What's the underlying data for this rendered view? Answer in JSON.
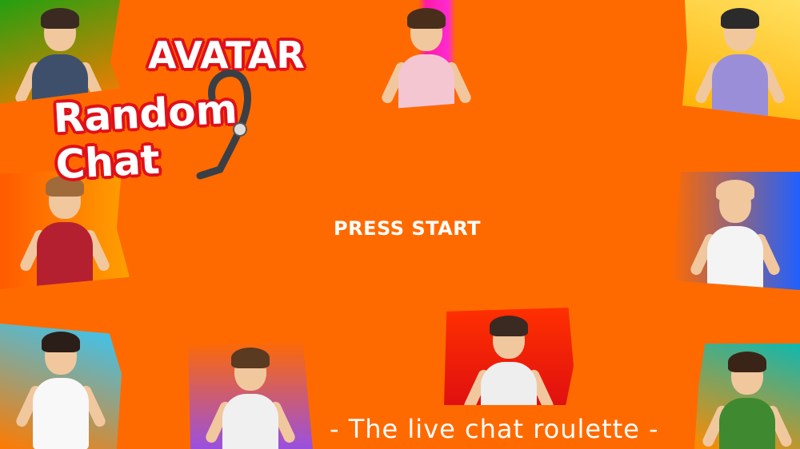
{
  "logo": {
    "line1": "AVATAR",
    "line2": "Random Chat"
  },
  "prompt": "PRESS START",
  "tagline": "- The live chat roulette -",
  "colors": {
    "background": "#ff6a00",
    "text": "#ffffff",
    "logo_outline": "#e0101a"
  },
  "avatars": [
    {
      "id": "top-left",
      "bg": "linear-gradient(160deg,#22a010,#ff7a00)",
      "shirt": "#3e4f6b",
      "hair": "#3a2a22"
    },
    {
      "id": "top-center",
      "bg": "linear-gradient(90deg,#ff6a00 0%,#ff6a00 45%,#ff1aa8 50%,#ff2ad0 65%,#ff6a00 70%)",
      "shirt": "#f4c6d2",
      "hair": "#4a2e1c"
    },
    {
      "id": "top-right",
      "bg": "linear-gradient(200deg,#ffe060,#ffb000)",
      "shirt": "#9a8ed8",
      "hair": "#2b2b2b"
    },
    {
      "id": "mid-left",
      "bg": "linear-gradient(90deg,#ff5a00,#ffa000)",
      "shirt": "#b52030",
      "hair": "#a06a3a"
    },
    {
      "id": "mid-right",
      "bg": "linear-gradient(90deg,#ff6a00,#2060ff)",
      "shirt": "#f4f4f4",
      "hair": "#f1c79e"
    },
    {
      "id": "bottom-left",
      "bg": "linear-gradient(200deg,#30c8ff,#ff7a00)",
      "shirt": "#f8f8f8",
      "hair": "#2b1e18"
    },
    {
      "id": "bottom-center-left",
      "bg": "linear-gradient(180deg,#ff6a00,#9a50e0)",
      "shirt": "#f0f0f0",
      "hair": "#5a3a20"
    },
    {
      "id": "bottom-center-right",
      "bg": "linear-gradient(180deg,#ff3000,#e01010)",
      "shirt": "#eeeeee",
      "hair": "#3a2a22"
    },
    {
      "id": "bottom-right",
      "bg": "linear-gradient(200deg,#10b8b0,#ff8a00)",
      "shirt": "#3f8a30",
      "hair": "#3a2418"
    }
  ]
}
